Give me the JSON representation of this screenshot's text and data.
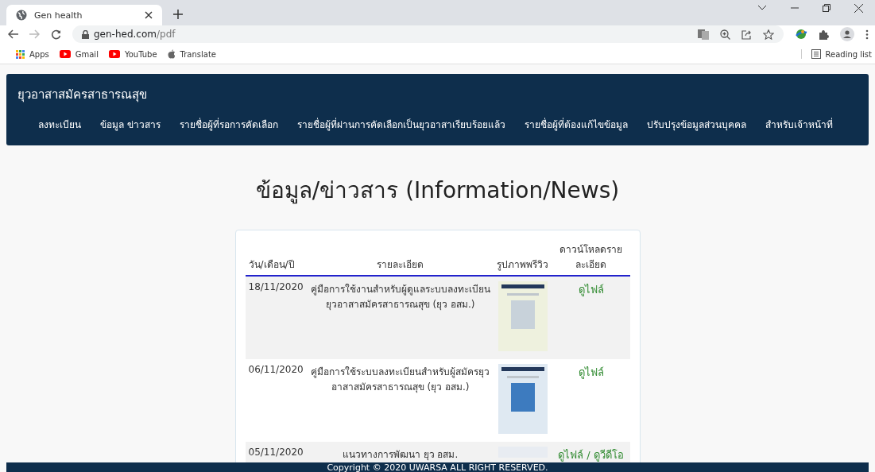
{
  "browser": {
    "tab": {
      "title": "Gen health",
      "selected": true
    },
    "url": {
      "host": "gen-hed.com",
      "path": "/pdf"
    },
    "bookmarks": [
      {
        "label": "Apps",
        "kind": "apps"
      },
      {
        "label": "Gmail",
        "kind": "video"
      },
      {
        "label": "YouTube",
        "kind": "video"
      },
      {
        "label": "Translate",
        "kind": "apple"
      }
    ],
    "reading_list": "Reading list"
  },
  "site": {
    "title": "ยุวอาสาสมัครสาธารณสุข",
    "nav": [
      "ลงทะเบียน",
      "ข้อมูล ข่าวสาร",
      "รายชื่อผู้ที่รอการคัดเลือก",
      "รายชื่อผู้ที่ผ่านการคัดเลือกเป็นยุวอาสาเรียบร้อยแล้ว",
      "รายชื่อผู้ที่ต้องแก้ไขข้อมูล",
      "ปรับปรุงข้อมูลส่วนบุคคล",
      "สำหรับเจ้าหน้าที่"
    ]
  },
  "heading": "ข้อมูล/ข่าวสาร (Information/News)",
  "table": {
    "columns": [
      "วัน/เดือน/ปี",
      "รายละเอียด",
      "รูปภาพพรีวิว",
      "ดาวน์โหลดรายละเอียด"
    ],
    "rows": [
      {
        "date": "18/11/2020",
        "detail": "คู่มือการใช้งานสำหรับผู้ดูแลระบบลงทะเบียน ยุวอาสาสมัครสาธารณสุข (ยุว อสม.)",
        "links": [
          "ดูไฟล์"
        ]
      },
      {
        "date": "06/11/2020",
        "detail": "คู่มือการใช้ระบบลงทะเบียนสำหรับผู้สมัครยุว อาสาสมัครสาธารณสุข (ยุว อสม.)",
        "links": [
          "ดูไฟล์"
        ]
      },
      {
        "date": "05/11/2020",
        "detail": "แนวทางการพัฒนา ยุว อสม.",
        "links": [
          "ดูไฟล์",
          "ดูวีดีโอ"
        ],
        "link_separator": "/"
      }
    ]
  },
  "footer": "Copyright © 2020 UWARSA ALL RIGHT RESERVED."
}
